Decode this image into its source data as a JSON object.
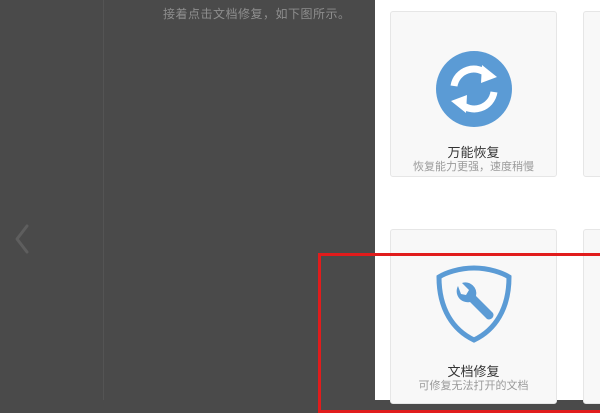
{
  "instruction": {
    "text": "接着点击文档修复，如下图所示。"
  },
  "cards": [
    {
      "title": "万能恢复",
      "desc": "恢复能力更强，速度稍慢",
      "icon": "sync-arrows-icon"
    },
    {
      "title": "文档修复",
      "desc": "可修复无法打开的文档",
      "icon": "shield-wrench-icon"
    }
  ],
  "nav": {
    "prev_icon": "chevron-left-icon"
  },
  "colors": {
    "icon_blue": "#5b9bd5",
    "highlight": "#e11c1c",
    "overlay": "#4a4a4a"
  }
}
